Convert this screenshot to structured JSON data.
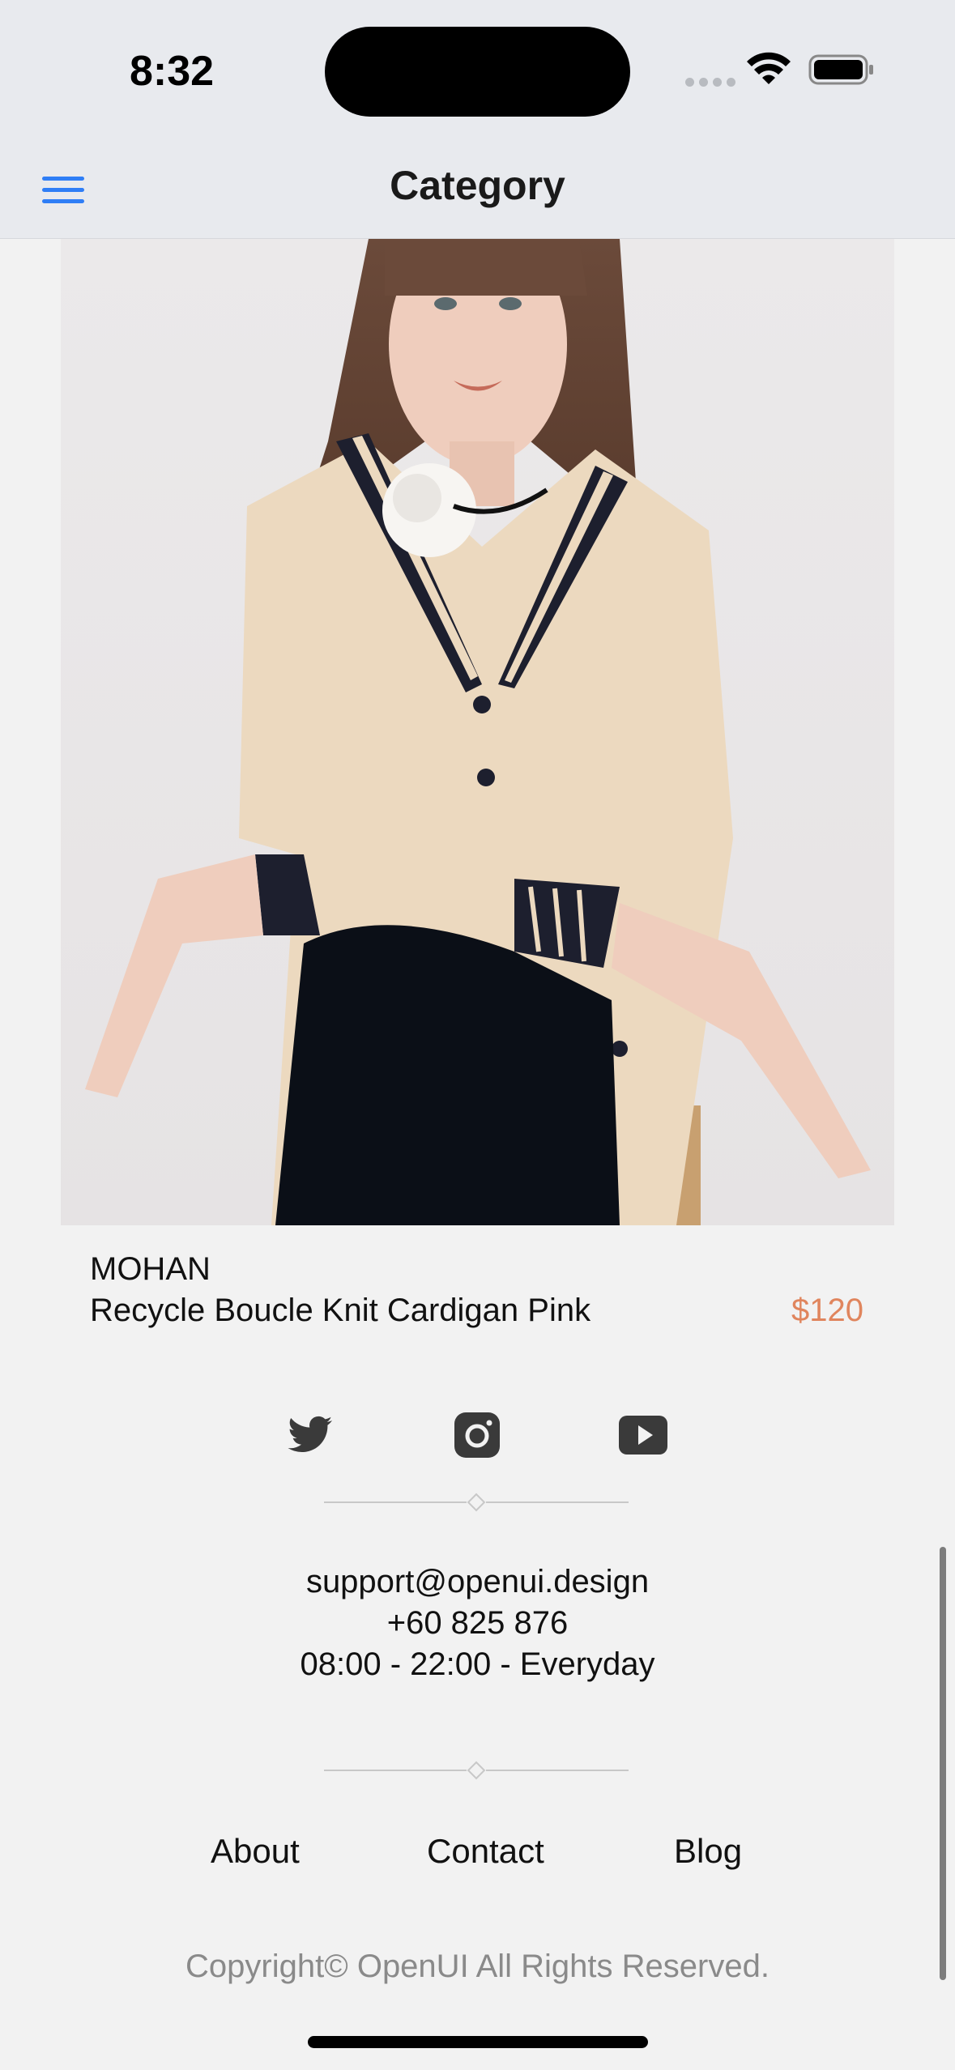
{
  "status": {
    "time": "8:32"
  },
  "nav": {
    "title": "Category",
    "menu_icon": "hamburger-menu-icon"
  },
  "product": {
    "image_alt": "model-wearing-cardigan-photo",
    "brand": "MOHAN",
    "name": "Recycle Boucle Knit Cardigan Pink",
    "price": "$120",
    "price_color": "#e0855d"
  },
  "social": {
    "icons": [
      "twitter-icon",
      "instagram-icon",
      "youtube-icon"
    ]
  },
  "contact": {
    "email": "support@openui.design",
    "phone": "+60 825 876",
    "hours": "08:00 - 22:00 - Everyday"
  },
  "links": {
    "about": "About",
    "contact": "Contact",
    "blog": "Blog"
  },
  "footer": {
    "copyright": "Copyright© OpenUI All Rights Reserved."
  },
  "colors": {
    "accent": "#2f7ef6",
    "background": "#f2f2f2",
    "header": "#e8eaee"
  }
}
